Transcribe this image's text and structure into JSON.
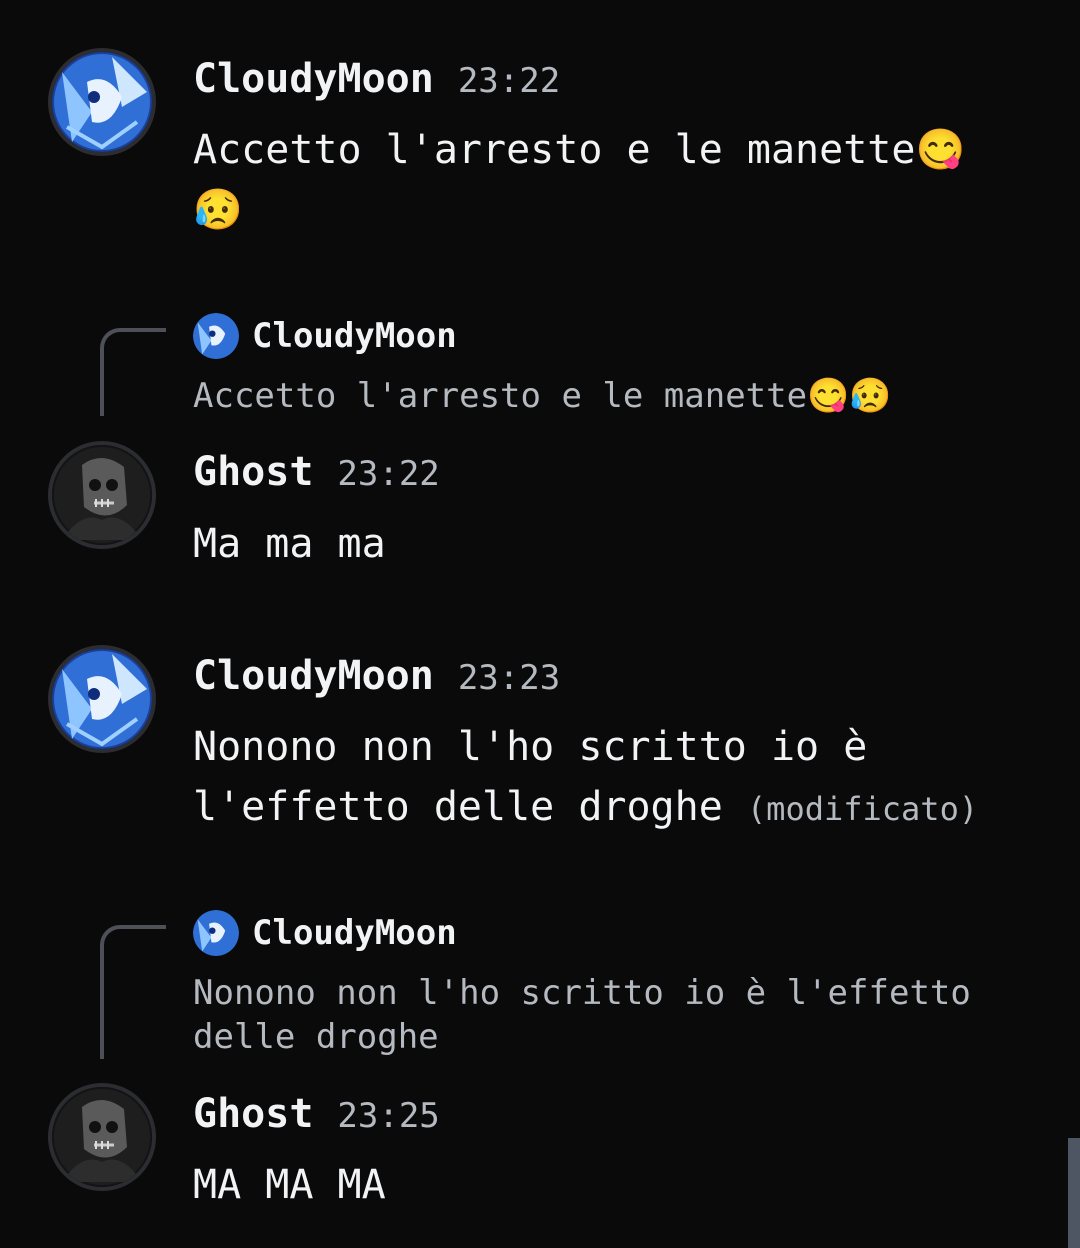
{
  "messages": [
    {
      "author": "CloudyMoon",
      "time": "23:22",
      "text": "Accetto l'arresto e le manette😋\n😥",
      "avatar": "cloudymoon-avatar"
    },
    {
      "reply": {
        "author": "CloudyMoon",
        "text": "Accetto l'arresto e le manette😋😥"
      },
      "author": "Ghost",
      "time": "23:22",
      "text": "Ma ma ma",
      "avatar": "ghost-avatar"
    },
    {
      "author": "CloudyMoon",
      "time": "23:23",
      "text": "Nonono non l'ho scritto io è\nl'effetto delle droghe",
      "edited": "(modificato)",
      "avatar": "cloudymoon-avatar"
    },
    {
      "reply": {
        "author": "CloudyMoon",
        "text": "Nonono non l'ho scritto io è l'effetto\ndelle droghe"
      },
      "author": "Ghost",
      "time": "23:25",
      "text": "MA MA MA",
      "avatar": "ghost-avatar"
    }
  ],
  "colors": {
    "background": "#0a0a0b",
    "author": "#f2f3f5",
    "timestamp": "#b5bac1",
    "reply_line": "#4e5058",
    "cloudymoon_avatar": "#2f6fd6",
    "ghost_avatar": "#3a3a3a"
  }
}
